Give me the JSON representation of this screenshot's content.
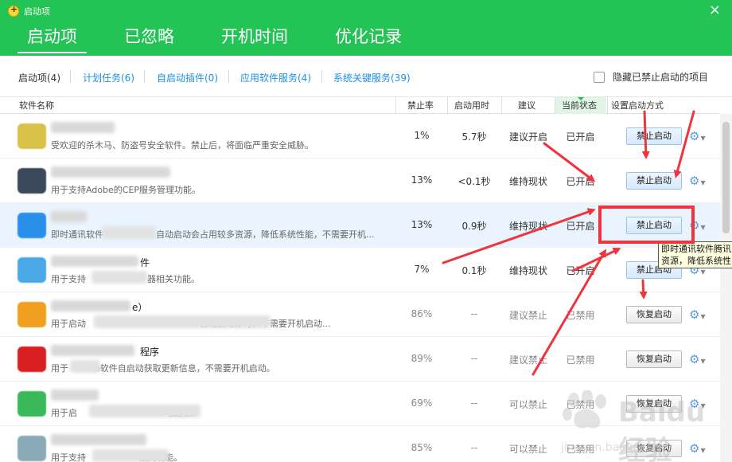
{
  "window": {
    "title": "启动项",
    "close_symbol": "×"
  },
  "main_tabs": [
    {
      "label": "启动项"
    },
    {
      "label": "已忽略"
    },
    {
      "label": "开机时间"
    },
    {
      "label": "优化记录"
    }
  ],
  "sub_tabs": [
    {
      "label": "启动项(4)"
    },
    {
      "label": "计划任务(6)"
    },
    {
      "label": "自启动插件(0)"
    },
    {
      "label": "应用软件服务(4)"
    },
    {
      "label": "系统关键服务(39)"
    }
  ],
  "hide_disabled_label": "隐藏已禁止启动的项目",
  "columns": {
    "name": "软件名称",
    "disable_rate": "禁止率",
    "boot_time": "启动用时",
    "advice": "建议",
    "status": "当前状态",
    "set_method": "设置启动方式"
  },
  "rows": [
    {
      "name": "",
      "desc": "受欢迎的杀木马、防盗号安全软件。禁止后，将面临严重安全威胁。",
      "rate": "1%",
      "time": "5.7秒",
      "advice": "建议开启",
      "status": "已开启",
      "action": "禁止启动",
      "icon_color": "#d8c24a"
    },
    {
      "name": "",
      "desc": "用于支持Adobe的CEP服务管理功能。",
      "rate": "13%",
      "time": "<0.1秒",
      "advice": "维持现状",
      "status": "已开启",
      "action": "禁止启动",
      "icon_color": "#3a4a5a"
    },
    {
      "name": "",
      "desc": "即时通讯软件　　　　　　自动启动会占用较多资源，降低系统性能，不需要开机...",
      "rate": "13%",
      "time": "0.9秒",
      "advice": "维持现状",
      "status": "已开启",
      "action": "禁止启动",
      "icon_color": "#2a8fe8"
    },
    {
      "name": "件",
      "desc": "用于支持　　　　　　　器相关功能。",
      "rate": "7%",
      "time": "0.1秒",
      "advice": "维持现状",
      "status": "已开启",
      "action": "禁止启动",
      "icon_color": "#4aa8e8"
    },
    {
      "name": "e）",
      "desc": "用于启动　　　　　　　　　　　　　自动启动即可，不需要开机启动...",
      "rate": "86%",
      "time": "--",
      "advice": "建议禁止",
      "status": "已禁用",
      "action": "恢复启动",
      "icon_color": "#f0a020"
    },
    {
      "name": "程序",
      "desc": "用于　　　e软件自启动获取更新信息，不需要开机启动。",
      "rate": "89%",
      "time": "--",
      "advice": "建议禁止",
      "status": "已禁用",
      "action": "恢复启动",
      "icon_color": "#d82020"
    },
    {
      "name": "",
      "desc": "用于启　　　　　　　　　　电脑版。",
      "rate": "69%",
      "time": "--",
      "advice": "可以禁止",
      "status": "已禁用",
      "action": "恢复启动",
      "icon_color": "#3ab85a"
    },
    {
      "name": "",
      "desc": "用于支持　　　　　　相关功能。",
      "rate": "85%",
      "time": "--",
      "advice": "可以禁止",
      "status": "已禁用",
      "action": "恢复启动",
      "icon_color": "#8aaab8"
    }
  ],
  "tooltip": {
    "line1": "即时通讯软件腾讯",
    "line2": "资源，降低系统性"
  },
  "annotation_color": "#f0343d",
  "watermark": {
    "text": "Baidu 经验",
    "sub": "jingyan.baidu.com"
  }
}
